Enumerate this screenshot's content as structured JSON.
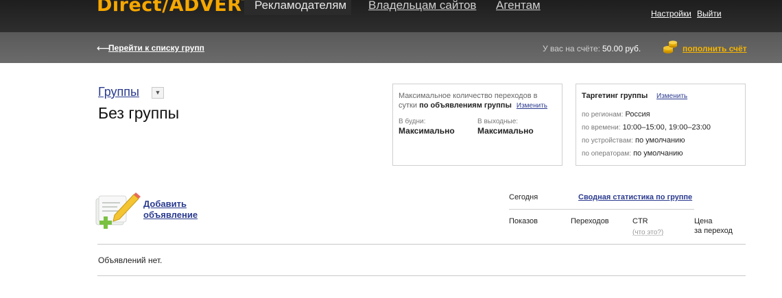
{
  "header": {
    "logo": "Direct/ADVERT",
    "tabs": [
      {
        "label": "Рекламодателям",
        "active": true
      },
      {
        "label": "Владельцам сайтов",
        "active": false
      },
      {
        "label": "Агентам",
        "active": false
      }
    ],
    "settings_label": "Настройки",
    "logout_label": "Выйти"
  },
  "subbar": {
    "back_label": "Перейти к списку групп",
    "balance_label": "У вас на счёте:",
    "balance_value": "50.00 руб.",
    "topup_label": "пополнить счёт"
  },
  "group": {
    "groups_link": "Группы",
    "dropdown_glyph": "▼",
    "name": "Без группы"
  },
  "clicks_box": {
    "title_text": "Максимальное количество переходов в сутки",
    "title_bold": "по объявлениям группы",
    "edit_label": "Изменить",
    "weekday_label": "В будни:",
    "weekday_value": "Максимально",
    "weekend_label": "В выходные:",
    "weekend_value": "Максимально"
  },
  "targeting": {
    "title": "Таргетинг группы",
    "edit_label": "Изменить",
    "rows": [
      {
        "key": "по регионам:",
        "value": "Россия"
      },
      {
        "key": "по времени:",
        "value": "10:00–15:00, 19:00–23:00"
      },
      {
        "key": "по устройствам:",
        "value": "по умолчанию"
      },
      {
        "key": "по операторам:",
        "value": "по умолчанию"
      }
    ]
  },
  "ads": {
    "add_line1": "Добавить",
    "add_line2": "объявление",
    "empty_text": "Объявлений нет."
  },
  "stats": {
    "today_label": "Сегодня",
    "summary_link": "Сводная статистика по группе",
    "col_shows": "Показов",
    "col_clicks": "Переходов",
    "col_ctr": "CTR",
    "ctr_help": "(что это?)",
    "col_price_line1": "Цена",
    "col_price_line2": "за переход"
  },
  "colors": {
    "accent": "#f6a700",
    "link": "#2a3a8f"
  }
}
